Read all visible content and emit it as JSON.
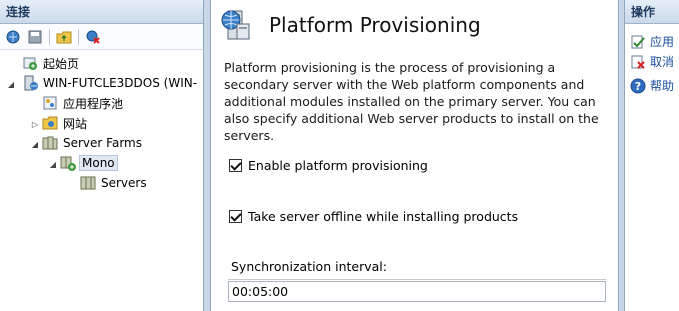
{
  "connections": {
    "title": "连接",
    "toolbar": [
      "connect-icon",
      "save-icon",
      "folder-up-icon",
      "disconnect-icon"
    ],
    "tree": [
      {
        "label": "起始页",
        "icon": "home-icon"
      },
      {
        "label": "WIN-FUTCLE3DDOS (WIN-",
        "icon": "server-icon"
      },
      {
        "label": "应用程序池",
        "icon": "app-pool-icon"
      },
      {
        "label": "网站",
        "icon": "sites-folder-icon"
      },
      {
        "label": "Server Farms",
        "icon": "server-farms-icon"
      },
      {
        "label": "Mono",
        "icon": "server-farm-icon"
      },
      {
        "label": "Servers",
        "icon": "servers-icon"
      }
    ]
  },
  "main": {
    "title": "Platform Provisioning",
    "description": "Platform provisioning is the process of provisioning a secondary server with the Web platform components and additional modules installed on the primary server. You can also specify additional Web server products to install on the servers.",
    "enable_label": "Enable platform provisioning",
    "enable_checked": true,
    "offline_label": "Take server offline while installing products",
    "offline_checked": true,
    "sync_label": "Synchronization interval:",
    "sync_value": "00:05:00"
  },
  "actions": {
    "title": "操作",
    "items": [
      {
        "label": "应用",
        "icon": "apply-icon"
      },
      {
        "label": "取消",
        "icon": "cancel-icon"
      },
      {
        "label": "帮助",
        "icon": "help-icon"
      }
    ]
  }
}
